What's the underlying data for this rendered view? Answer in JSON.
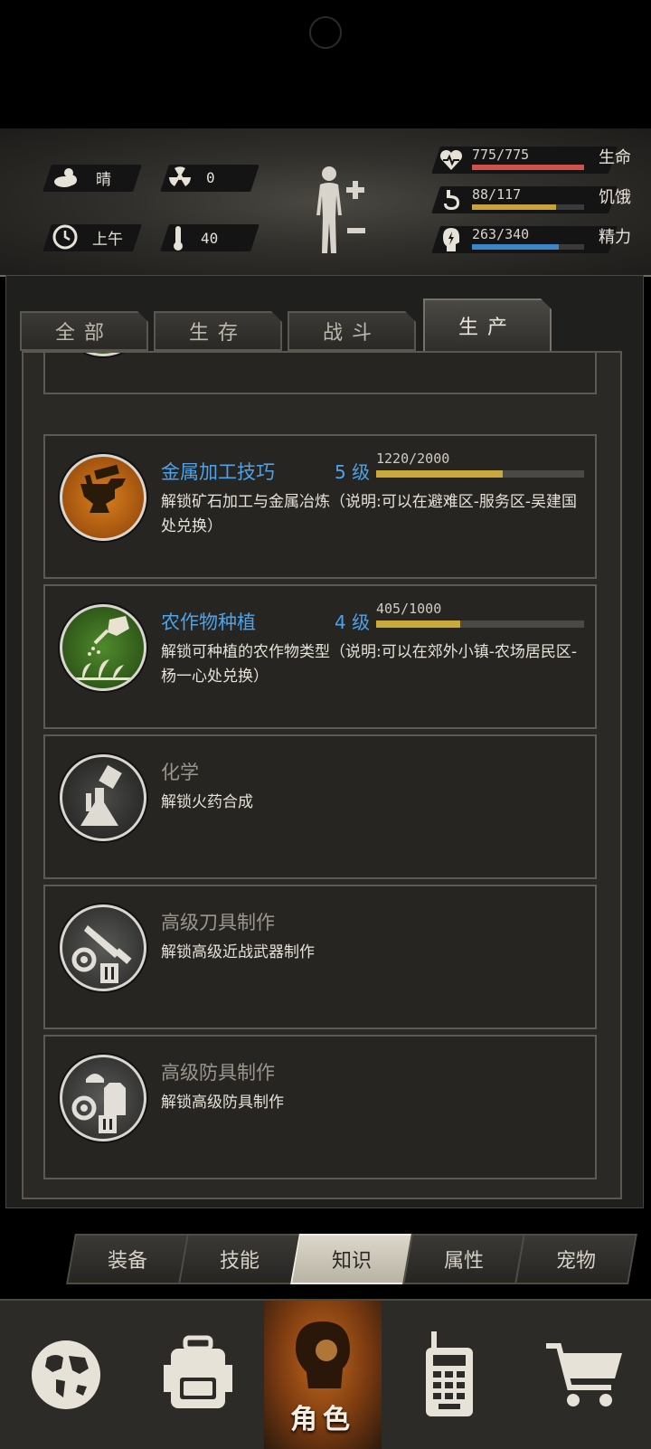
{
  "status": {
    "weather": "晴",
    "radiation": "0",
    "time_of_day": "上午",
    "temperature": "40",
    "health": {
      "text": "775/775",
      "label": "生命",
      "fraction": 1.0,
      "color": "#d2504a"
    },
    "hunger": {
      "text": "88/117",
      "label": "饥饿",
      "fraction": 0.752,
      "color": "#c9a23a"
    },
    "energy": {
      "text": "263/340",
      "label": "精力",
      "fraction": 0.774,
      "color": "#3b86c8"
    }
  },
  "tabs": [
    {
      "label": "全部",
      "active": false
    },
    {
      "label": "生存",
      "active": false
    },
    {
      "label": "战斗",
      "active": false
    },
    {
      "label": "生产",
      "active": true
    }
  ],
  "skills": [
    {
      "name": "金属加工技巧",
      "level": "5 级",
      "progress_text": "1220/2000",
      "progress": 0.61,
      "desc": "解锁矿石加工与金属冶炼（说明:可以在避难区-服务区-吴建国处兑换）",
      "unlocked": true,
      "icon": "anvil-hammer-icon"
    },
    {
      "name": "农作物种植",
      "level": "4 级",
      "progress_text": "405/1000",
      "progress": 0.405,
      "desc": "解锁可种植的农作物类型（说明:可以在郊外小镇-农场居民区-杨一心处兑换）",
      "unlocked": true,
      "icon": "watering-can-icon"
    },
    {
      "name": "化学",
      "level": "",
      "progress_text": "",
      "progress": 0,
      "desc": "解锁火药合成",
      "unlocked": false,
      "icon": "flask-icon"
    },
    {
      "name": "高级刀具制作",
      "level": "",
      "progress_text": "",
      "progress": 0,
      "desc": "解锁高级近战武器制作",
      "unlocked": false,
      "icon": "knife-gear-icon"
    },
    {
      "name": "高级防具制作",
      "level": "",
      "progress_text": "",
      "progress": 0,
      "desc": "解锁高级防具制作",
      "unlocked": false,
      "icon": "armor-gear-icon"
    }
  ],
  "subtabs": [
    {
      "label": "装备",
      "active": false
    },
    {
      "label": "技能",
      "active": false
    },
    {
      "label": "知识",
      "active": true
    },
    {
      "label": "属性",
      "active": false
    },
    {
      "label": "宠物",
      "active": false
    }
  ],
  "bottom_nav": {
    "active_label": "角色",
    "items": [
      "globe-icon",
      "backpack-icon",
      "character-icon",
      "radio-icon",
      "cart-icon"
    ]
  }
}
